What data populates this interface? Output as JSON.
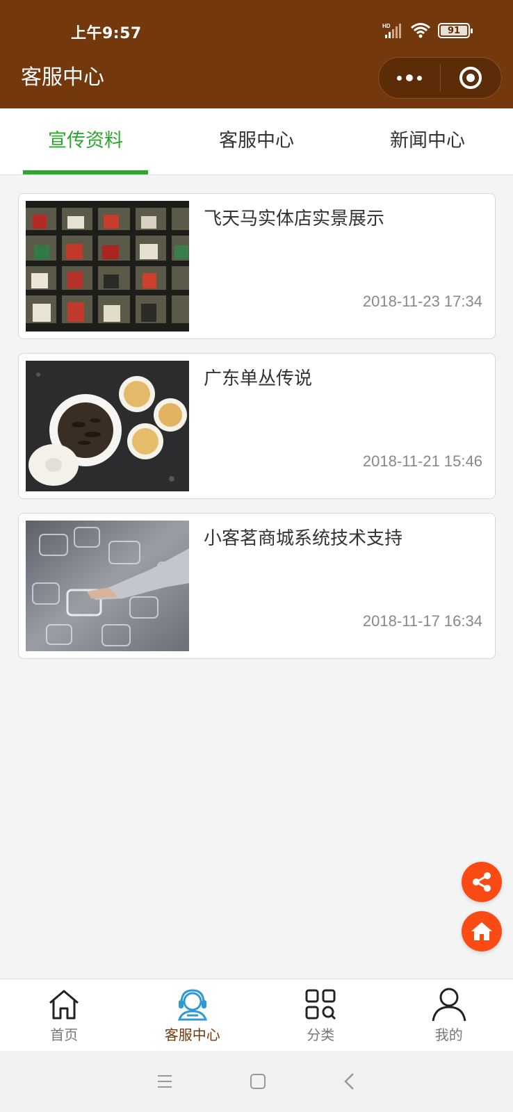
{
  "status_bar": {
    "time": "上午9:57",
    "battery": "91"
  },
  "header": {
    "title": "客服中心"
  },
  "tabs": [
    {
      "label": "宣传资料",
      "active": true
    },
    {
      "label": "客服中心",
      "active": false
    },
    {
      "label": "新闻中心",
      "active": false
    }
  ],
  "articles": [
    {
      "title": "飞天马实体店实景展示",
      "date": "2018-11-23 17:34",
      "image": "tea-store-shelves"
    },
    {
      "title": "广东单丛传说",
      "date": "2018-11-21 15:46",
      "image": "tea-cups"
    },
    {
      "title": "小客茗商城系统技术支持",
      "date": "2018-11-17 16:34",
      "image": "tech-hand-screens"
    }
  ],
  "floating": {
    "share_icon": "share-icon",
    "home_icon": "home-icon",
    "color": "#fb4b14"
  },
  "bottom_nav": [
    {
      "label": "首页",
      "icon": "home-outline-icon",
      "active": false
    },
    {
      "label": "客服中心",
      "icon": "customer-service-icon",
      "active": true
    },
    {
      "label": "分类",
      "icon": "category-grid-icon",
      "active": false
    },
    {
      "label": "我的",
      "icon": "user-icon",
      "active": false
    }
  ],
  "colors": {
    "header_bg": "#73380b",
    "tab_active": "#2aa82a",
    "nav_active": "#73380b",
    "nav_active_icon": "#2d9ad6"
  }
}
